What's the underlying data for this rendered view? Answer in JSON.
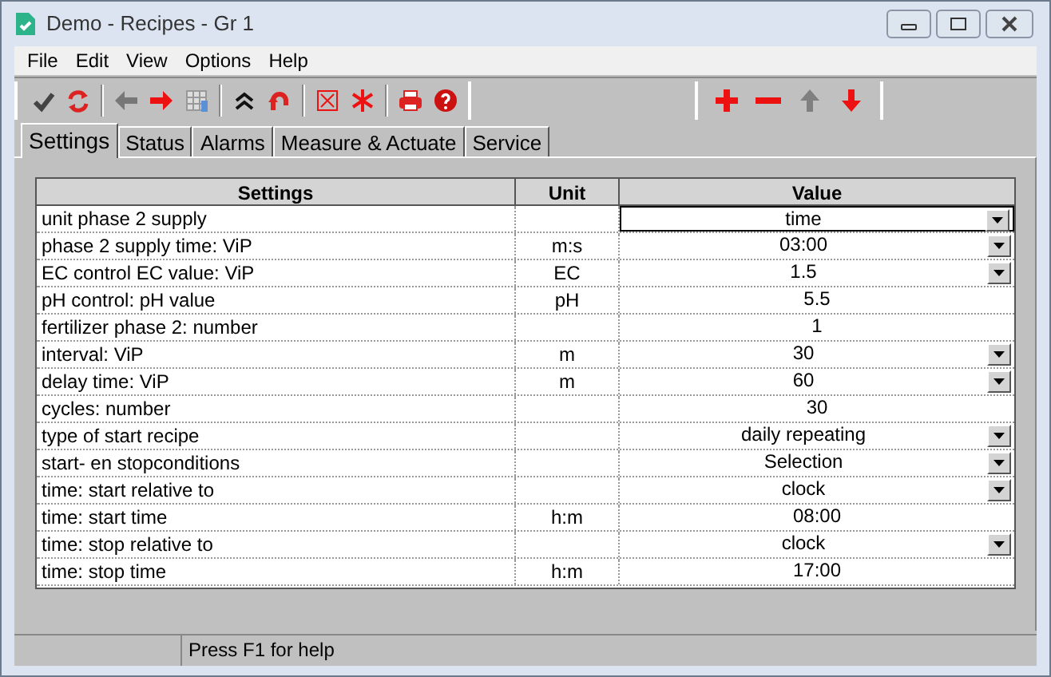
{
  "window": {
    "title": "Demo - Recipes - Gr 1"
  },
  "menu": [
    "File",
    "Edit",
    "View",
    "Options",
    "Help"
  ],
  "toolbar": [
    {
      "kind": "check",
      "disabled": true
    },
    {
      "kind": "refresh",
      "disabled": false
    },
    {
      "kind": "sep"
    },
    {
      "kind": "left",
      "disabled": true
    },
    {
      "kind": "right",
      "disabled": false
    },
    {
      "kind": "grid",
      "disabled": true
    },
    {
      "kind": "sep"
    },
    {
      "kind": "collapse",
      "disabled": false
    },
    {
      "kind": "undo",
      "disabled": false
    },
    {
      "kind": "sep"
    },
    {
      "kind": "xbox",
      "disabled": false
    },
    {
      "kind": "asterisk",
      "disabled": false
    },
    {
      "kind": "sep"
    },
    {
      "kind": "print",
      "disabled": false
    },
    {
      "kind": "help",
      "disabled": false
    }
  ],
  "toolbar2": [
    {
      "kind": "plus",
      "disabled": false
    },
    {
      "kind": "minus",
      "disabled": false
    },
    {
      "kind": "up",
      "disabled": true
    },
    {
      "kind": "down",
      "disabled": false
    }
  ],
  "tabs": [
    {
      "label": "Settings",
      "selected": true
    },
    {
      "label": "Status",
      "selected": false
    },
    {
      "label": "Alarms",
      "selected": false
    },
    {
      "label": "Measure & Actuate",
      "selected": false
    },
    {
      "label": "Service",
      "selected": false
    }
  ],
  "table": {
    "columns": [
      "Settings",
      "Unit",
      "Value"
    ],
    "rows": [
      {
        "setting": "unit phase 2 supply",
        "unit": "",
        "value": "time",
        "dropdown": true,
        "selected": true
      },
      {
        "setting": "phase 2 supply time: ViP",
        "unit": "m:s",
        "value": "03:00",
        "dropdown": true,
        "selected": false
      },
      {
        "setting": "EC control EC value: ViP",
        "unit": "EC",
        "value": "1.5",
        "dropdown": true,
        "selected": false
      },
      {
        "setting": "pH control: pH value",
        "unit": "pH",
        "value": "5.5",
        "dropdown": false,
        "selected": false
      },
      {
        "setting": "fertilizer phase 2: number",
        "unit": "",
        "value": "1",
        "dropdown": false,
        "selected": false
      },
      {
        "setting": "interval: ViP",
        "unit": "m",
        "value": "30",
        "dropdown": true,
        "selected": false
      },
      {
        "setting": "delay time: ViP",
        "unit": "m",
        "value": "60",
        "dropdown": true,
        "selected": false
      },
      {
        "setting": "cycles: number",
        "unit": "",
        "value": "30",
        "dropdown": false,
        "selected": false
      },
      {
        "setting": "type of start recipe",
        "unit": "",
        "value": "daily repeating",
        "dropdown": true,
        "selected": false
      },
      {
        "setting": "start- en stopconditions",
        "unit": "",
        "value": "Selection",
        "dropdown": true,
        "selected": false
      },
      {
        "setting": "time: start relative to",
        "unit": "",
        "value": "clock",
        "dropdown": true,
        "selected": false
      },
      {
        "setting": "time: start time",
        "unit": "h:m",
        "value": "08:00",
        "dropdown": false,
        "selected": false
      },
      {
        "setting": "time: stop relative to",
        "unit": "",
        "value": "clock",
        "dropdown": true,
        "selected": false
      },
      {
        "setting": "time: stop time",
        "unit": "h:m",
        "value": "17:00",
        "dropdown": false,
        "selected": false
      }
    ]
  },
  "status_bar": {
    "text": "Press F1 for help"
  }
}
